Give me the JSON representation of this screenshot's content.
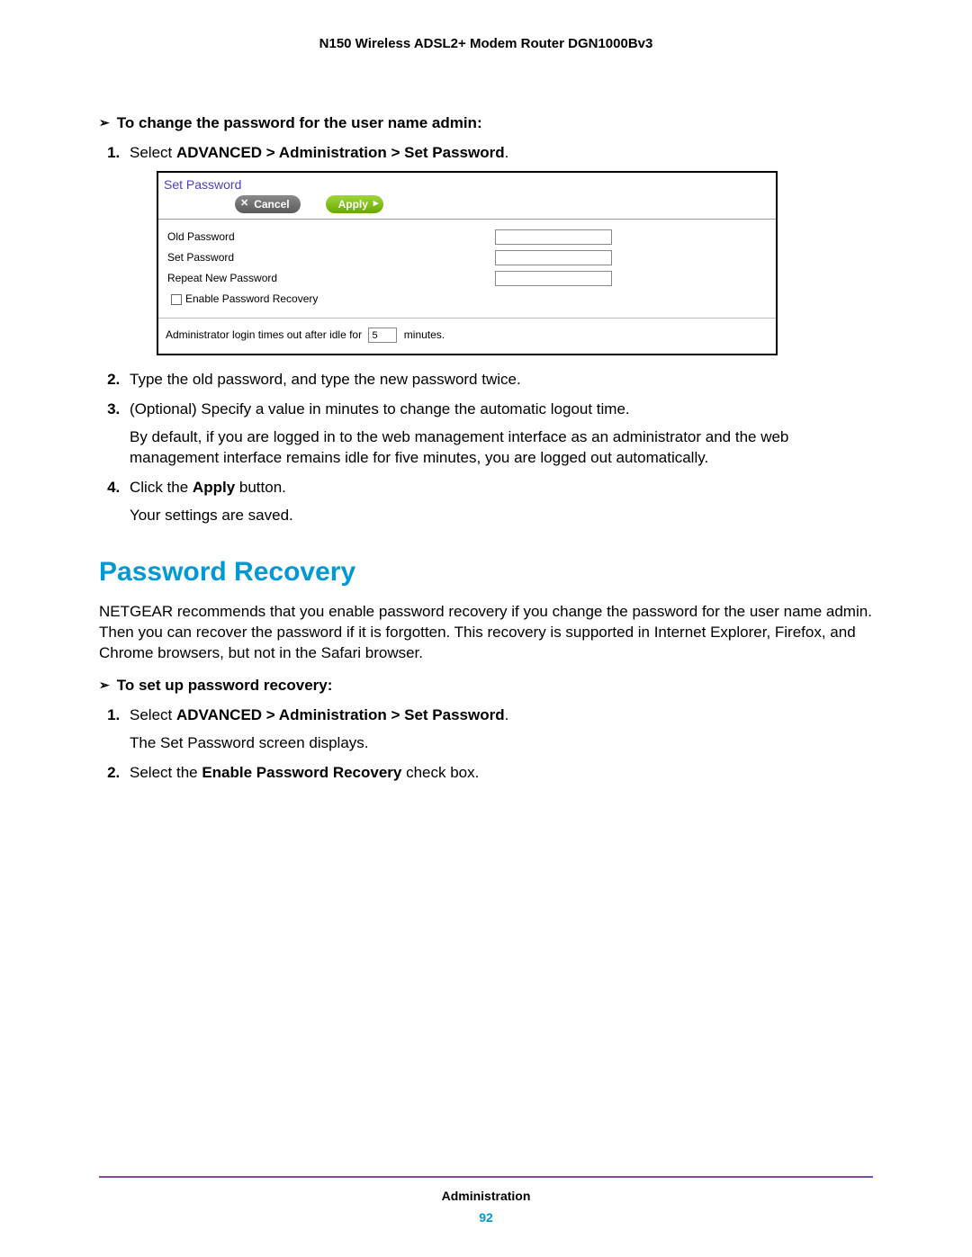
{
  "header": {
    "title": "N150 Wireless ADSL2+ Modem Router DGN1000Bv3"
  },
  "proc1": {
    "heading": "To change the password for the user name admin:",
    "steps": {
      "s1_pre": "Select ",
      "s1_bold": "ADVANCED > Administration > Set Password",
      "s1_post": ".",
      "s2": "Type the old password, and type the new password twice.",
      "s3": "(Optional) Specify a value in minutes to change the automatic logout time.",
      "s3_extra": "By default, if you are logged in to the web management interface as an administrator and the web management interface remains idle for five minutes, you are logged out automatically.",
      "s4_pre": "Click the ",
      "s4_bold": "Apply",
      "s4_post": " button.",
      "s4_extra": "Your settings are saved."
    }
  },
  "figure": {
    "title": "Set Password",
    "cancel_label": "Cancel",
    "apply_label": "Apply",
    "row_old": "Old Password",
    "row_new": "Set Password",
    "row_repeat": "Repeat New Password",
    "chk_label": "Enable Password Recovery",
    "idle_pre": "Administrator login times out after idle for",
    "idle_value": "5",
    "idle_post": "minutes."
  },
  "section": {
    "heading": "Password Recovery",
    "intro": "NETGEAR recommends that you enable password recovery if you change the password for the user name admin. Then you can recover the password if it is forgotten. This recovery is supported in Internet Explorer, Firefox, and Chrome browsers, but not in the Safari browser."
  },
  "proc2": {
    "heading": "To set up password recovery:",
    "steps": {
      "s1_pre": "Select ",
      "s1_bold": "ADVANCED > Administration > Set Password",
      "s1_post": ".",
      "s1_extra": "The Set Password screen displays.",
      "s2_pre": "Select the ",
      "s2_bold": "Enable Password Recovery",
      "s2_post": " check box."
    }
  },
  "footer": {
    "section": "Administration",
    "page": "92"
  }
}
